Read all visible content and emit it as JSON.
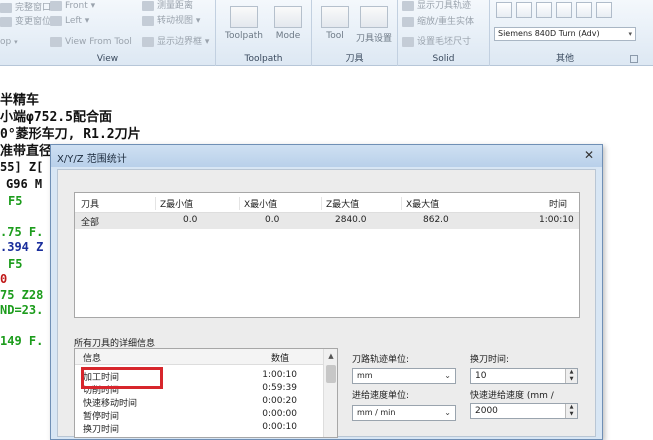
{
  "ribbon": {
    "view_group": {
      "items": [
        "完整窗口",
        "变更窗位",
        "op"
      ],
      "items2": [
        "Front",
        "Left",
        "View From Tool"
      ],
      "items3": [
        "测量距离",
        "转动视图",
        "显示边界框"
      ],
      "caption": "View"
    },
    "toolpath_group": {
      "buttons": [
        "Toolpath",
        "Mode"
      ],
      "caption": "Toolpath"
    },
    "tool_group": {
      "buttons": [
        "Tool",
        "刀具设置"
      ],
      "caption": "刀具"
    },
    "solid_group": {
      "items": [
        "显示刀具轨迹",
        "缩放/重生实体",
        "设置毛坯尺寸"
      ],
      "caption": "Solid"
    },
    "misc_group": {
      "controller": "Siemens 840D Turn (Adv)",
      "caption": "其他"
    }
  },
  "code_lines": [
    "半精车",
    "小端φ752.5配合面",
    "0°菱形车刀, R1.2刀片",
    "准带直径",
    "55] Z[",
    "G96 M",
    "F5",
    ".75 F.",
    ".394 Z",
    "F5",
    "0",
    "75 Z28",
    "ND=23.",
    "149 F."
  ],
  "dialog": {
    "title": "X/Y/Z 范围统计",
    "close_symbol": "✕",
    "summary": {
      "columns": [
        "刀具",
        "Z最小值",
        "X最小值",
        "Z最大值",
        "X最大值",
        "时间"
      ],
      "rows": [
        {
          "tool": "全部",
          "z_min": "0.0",
          "x_min": "0.0",
          "z_max": "2840.0",
          "x_max": "862.0",
          "time": "1:00:10"
        }
      ]
    },
    "details": {
      "label": "所有刀具的详细信息",
      "columns": [
        "信息",
        "数值"
      ],
      "rows": [
        {
          "name": "加工时间",
          "value": "1:00:10"
        },
        {
          "name": "切削时间",
          "value": "0:59:39"
        },
        {
          "name": "快速移动时间",
          "value": "0:00:20"
        },
        {
          "name": "暂停时间",
          "value": "0:00:00"
        },
        {
          "name": "换刀时间",
          "value": "0:00:10"
        }
      ],
      "highlighted_row": "加工时间"
    },
    "form": {
      "path_unit_label": "刀路轨迹单位:",
      "path_unit_value": "mm",
      "feed_unit_label": "进给速度单位:",
      "feed_unit_value": "mm / min",
      "tool_change_label": "换刀时间:",
      "tool_change_value": "10",
      "rapid_feed_label": "快速进给速度 (mm /",
      "rapid_feed_value": "2000"
    }
  },
  "colors": {
    "highlight": "#d7262c",
    "code_green": "#1c9c1c",
    "code_blue": "#1a2e9c",
    "code_red": "#c01818"
  }
}
